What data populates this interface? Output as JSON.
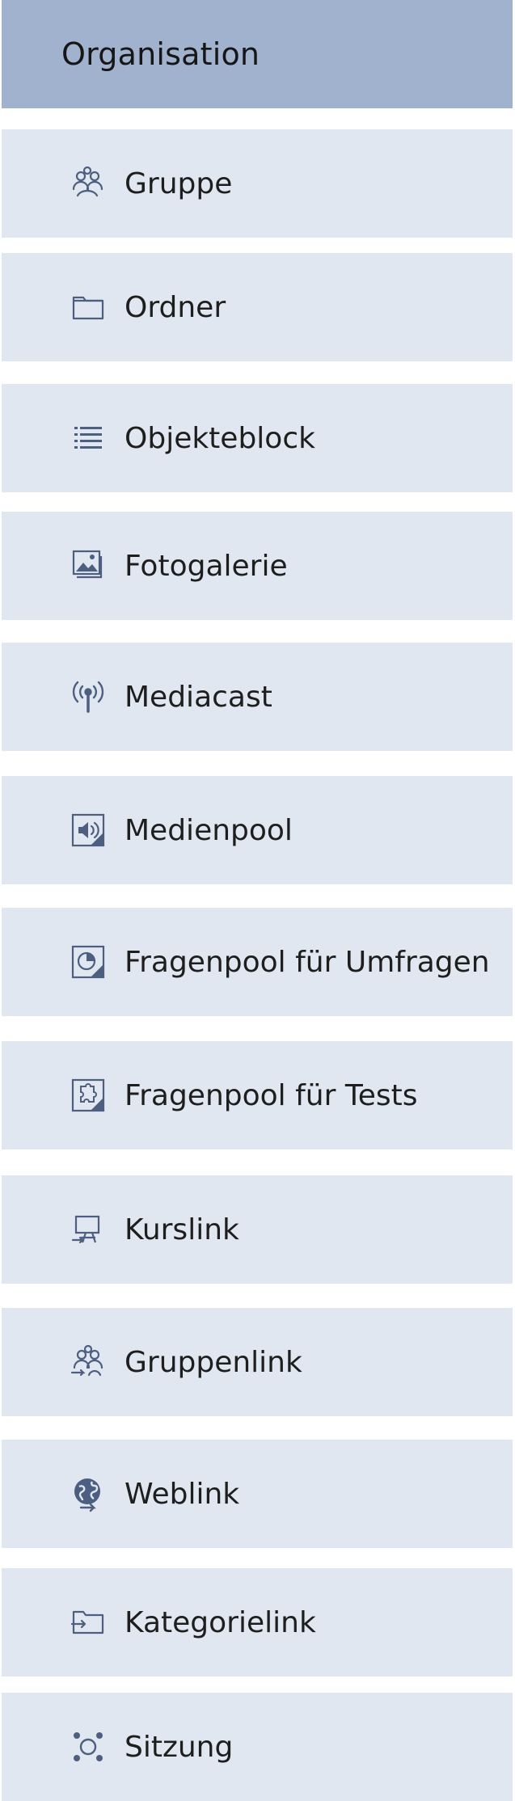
{
  "header": {
    "title": "Organisation"
  },
  "items": [
    {
      "label": "Gruppe",
      "icon": "group-icon"
    },
    {
      "label": "Ordner",
      "icon": "folder-icon"
    },
    {
      "label": "Objekteblock",
      "icon": "list-icon"
    },
    {
      "label": "Fotogalerie",
      "icon": "photo-gallery-icon"
    },
    {
      "label": "Mediacast",
      "icon": "broadcast-icon"
    },
    {
      "label": "Medienpool",
      "icon": "speaker-icon"
    },
    {
      "label": "Fragenpool für Umfragen",
      "icon": "survey-pool-icon"
    },
    {
      "label": "Fragenpool für Tests",
      "icon": "test-pool-icon"
    },
    {
      "label": "Kurslink",
      "icon": "course-link-icon"
    },
    {
      "label": "Gruppenlink",
      "icon": "group-link-icon"
    },
    {
      "label": "Weblink",
      "icon": "weblink-icon"
    },
    {
      "label": "Kategorielink",
      "icon": "category-link-icon"
    },
    {
      "label": "Sitzung",
      "icon": "session-icon"
    }
  ],
  "colors": {
    "header_bg": "#a1b2ce",
    "item_bg": "#e1e7f0",
    "icon": "#4c5f80"
  }
}
